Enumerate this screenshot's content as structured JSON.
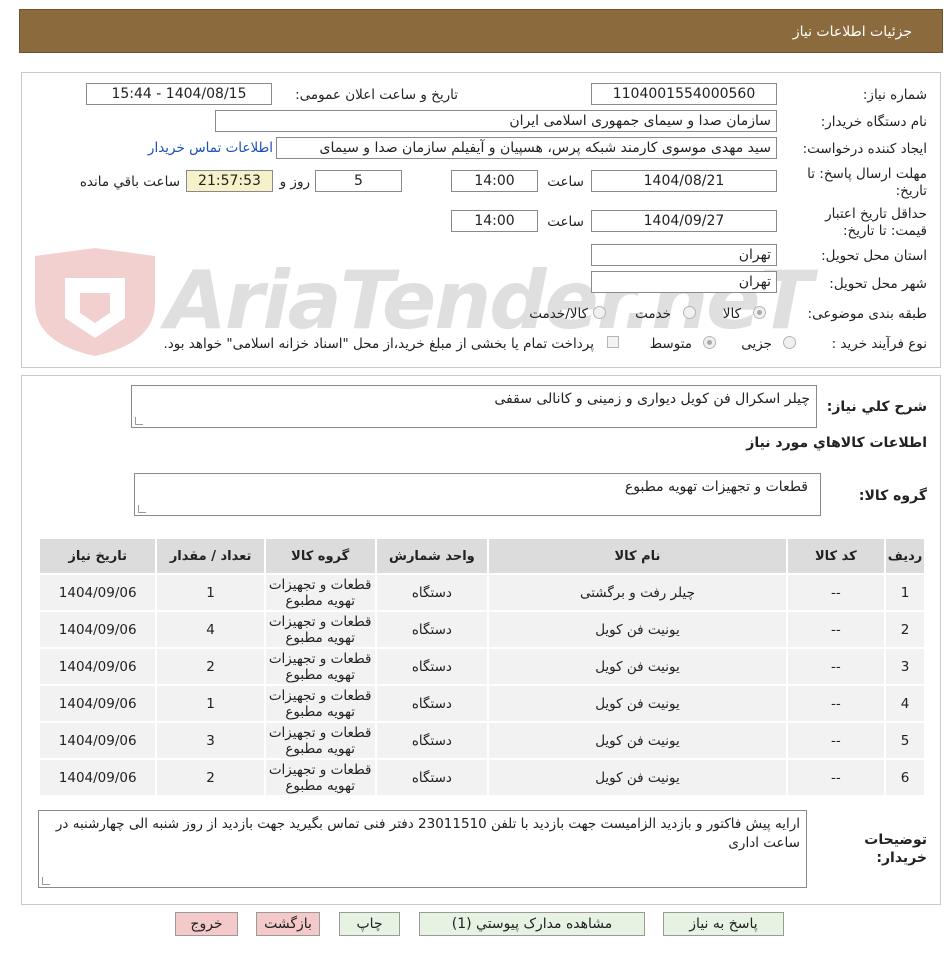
{
  "header": {
    "title": "جزئیات اطلاعات نیاز"
  },
  "watermark": {
    "text": "AriaTender.neT"
  },
  "form": {
    "need_number_label": "شماره نیاز:",
    "need_number": "1104001554000560",
    "announce_label": "تاریخ و ساعت اعلان عمومی:",
    "announce_value": "1404/08/15 - 15:44",
    "buyer_org_label": "نام دستگاه خریدار:",
    "buyer_org": "سازمان صدا و سیمای جمهوری اسلامی ایران",
    "requester_label": "ایجاد کننده درخواست:",
    "requester": "سید مهدی موسوی کارمند شبکه پرس، هسپیان و آیفیلم سازمان صدا و سیمای",
    "contact_link": "اطلاعات تماس خریدار",
    "deadline_label_1": "مهلت ارسال پاسخ: تا",
    "deadline_label_2": "تاریخ:",
    "deadline_date": "1404/08/21",
    "time_label": "ساعت",
    "deadline_time": "14:00",
    "days": "5",
    "days_label": "روز و",
    "remaining": "21:57:53",
    "remaining_label": "ساعت باقي مانده",
    "validity_label_1": "حداقل تاریخ اعتبار",
    "validity_label_2": "قیمت: تا تاریخ:",
    "validity_date": "1404/09/27",
    "validity_time": "14:00",
    "province_label": "استان محل تحویل:",
    "province": "تهران",
    "city_label": "شهر محل تحویل:",
    "city": "تهران",
    "category_label": "طبقه بندی موضوعی:",
    "category_goods": "کالا",
    "category_service": "خدمت",
    "category_both": "کالا/خدمت",
    "process_label": "نوع فرآیند خرید :",
    "process_partial": "جزیی",
    "process_medium": "متوسط",
    "payment_note": "پرداخت تمام یا بخشی از مبلغ خرید،از محل \"اسناد خزانه اسلامی\" خواهد بود."
  },
  "summary": {
    "desc_label": "شرح کلي نیاز:",
    "desc": "چیلر اسکرال فن کویل دیواری و زمینی و کانالی سقفی",
    "items_title": "اطلاعات کالاهاي مورد نیاز",
    "group_label": "گروه کالا:",
    "group": "قطعات و تجهیزات تهویه مطبوع"
  },
  "table": {
    "headers": [
      "ردیف",
      "کد کالا",
      "نام کالا",
      "واحد شمارش",
      "گروه کالا",
      "تعداد / مقدار",
      "تاریخ نیاز"
    ],
    "rows": [
      [
        "1",
        "--",
        "چیلر رفت و برگشتی",
        "دستگاه",
        "قطعات و تجهیزات تهویه مطبوع",
        "1",
        "1404/09/06"
      ],
      [
        "2",
        "--",
        "یونیت فن کویل",
        "دستگاه",
        "قطعات و تجهیزات تهویه مطبوع",
        "4",
        "1404/09/06"
      ],
      [
        "3",
        "--",
        "یونیت فن کویل",
        "دستگاه",
        "قطعات و تجهیزات تهویه مطبوع",
        "2",
        "1404/09/06"
      ],
      [
        "4",
        "--",
        "یونیت فن کویل",
        "دستگاه",
        "قطعات و تجهیزات تهویه مطبوع",
        "1",
        "1404/09/06"
      ],
      [
        "5",
        "--",
        "یونیت فن کویل",
        "دستگاه",
        "قطعات و تجهیزات تهویه مطبوع",
        "3",
        "1404/09/06"
      ],
      [
        "6",
        "--",
        "یونیت فن کویل",
        "دستگاه",
        "قطعات و تجهیزات تهویه مطبوع",
        "2",
        "1404/09/06"
      ]
    ]
  },
  "notes": {
    "label_1": "توضیحات",
    "label_2": "خریدار:",
    "text": "ارایه پیش فاکتور و بازدید الزامیست جهت بازدید با تلفن 23011510 دفتر فنی تماس بگیرید جهت بازدید از روز شنبه الی چهارشنبه در ساعت اداری"
  },
  "buttons": {
    "reply": "پاسخ به نیاز",
    "attachments": "مشاهده مدارک پیوستي (1)",
    "print": "چاپ",
    "back": "بازگشت",
    "exit": "خروج"
  }
}
